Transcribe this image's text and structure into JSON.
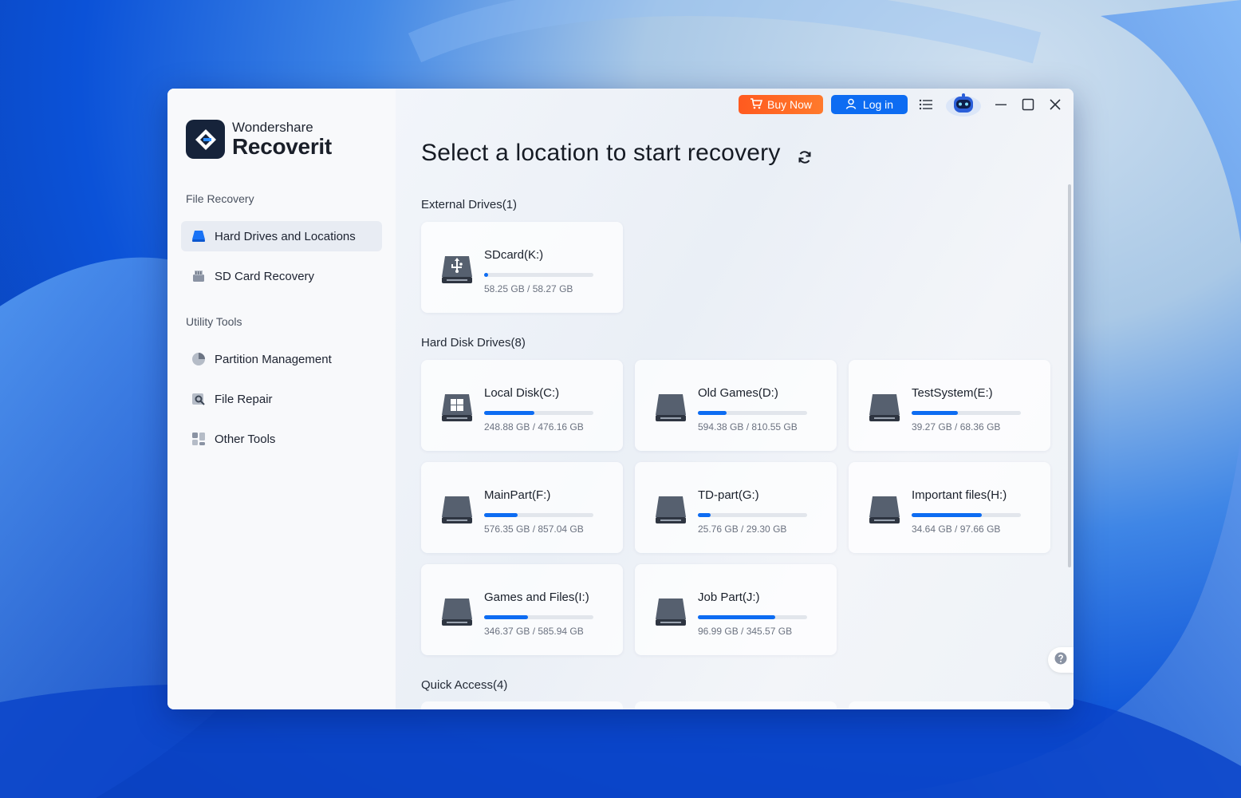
{
  "app": {
    "brand": "Wondershare",
    "product": "Recoverit"
  },
  "sidebar": {
    "sections": [
      {
        "title": "File Recovery"
      },
      {
        "title": "Utility Tools"
      }
    ],
    "items": [
      {
        "label": "Hard Drives and Locations",
        "icon": "hard-drive-icon",
        "active": true
      },
      {
        "label": "SD Card Recovery",
        "icon": "sd-card-icon"
      },
      {
        "label": "Partition Management",
        "icon": "pie-chart-icon"
      },
      {
        "label": "File Repair",
        "icon": "file-repair-icon"
      },
      {
        "label": "Other Tools",
        "icon": "grid-tools-icon"
      }
    ]
  },
  "topbar": {
    "buy_label": "Buy Now",
    "login_label": "Log in"
  },
  "main": {
    "title": "Select a location to start recovery",
    "groups": [
      {
        "title": "External Drives(1)"
      },
      {
        "title": "Hard Disk Drives(8)"
      },
      {
        "title": "Quick Access(4)"
      }
    ],
    "external_drives": [
      {
        "name": "SDcard(K:)",
        "size": "58.25 GB / 58.27 GB",
        "used_fraction": 0.04,
        "icon": "usb-drive-icon"
      }
    ],
    "hard_drives": [
      {
        "name": "Local Disk(C:)",
        "size": "248.88 GB / 476.16 GB",
        "used_fraction": 0.46,
        "icon": "windows-drive-icon"
      },
      {
        "name": "Old Games(D:)",
        "size": "594.38 GB / 810.55 GB",
        "used_fraction": 0.26,
        "icon": "hard-drive-icon"
      },
      {
        "name": "TestSystem(E:)",
        "size": "39.27 GB / 68.36 GB",
        "used_fraction": 0.42,
        "icon": "hard-drive-icon"
      },
      {
        "name": "MainPart(F:)",
        "size": "576.35 GB / 857.04 GB",
        "used_fraction": 0.31,
        "icon": "hard-drive-icon"
      },
      {
        "name": "TD-part(G:)",
        "size": "25.76 GB / 29.30 GB",
        "used_fraction": 0.12,
        "icon": "hard-drive-icon"
      },
      {
        "name": "Important files(H:)",
        "size": "34.64 GB / 97.66 GB",
        "used_fraction": 0.64,
        "icon": "hard-drive-icon"
      },
      {
        "name": "Games and Files(I:)",
        "size": "346.37 GB / 585.94 GB",
        "used_fraction": 0.4,
        "icon": "hard-drive-icon"
      },
      {
        "name": "Job Part(J:)",
        "size": "96.99 GB / 345.57 GB",
        "used_fraction": 0.71,
        "icon": "hard-drive-icon"
      }
    ]
  },
  "colors": {
    "accent": "#0d6cf2",
    "buy": "#ff6a24",
    "logo_bg": "#16233a"
  }
}
